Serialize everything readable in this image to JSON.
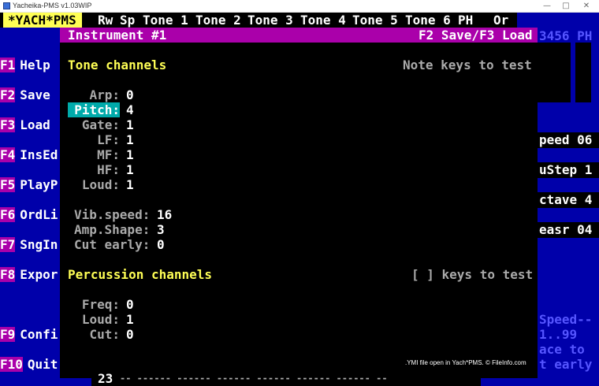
{
  "window": {
    "title": "Yacheika-PMS v1.03WIP"
  },
  "menu": {
    "logo": "*YACH*PMS",
    "columns": [
      "Rw",
      "Sp",
      "Tone 1",
      "Tone 2",
      "Tone 3",
      "Tone 4",
      "Tone 5",
      "Tone 6",
      "PH",
      "Or"
    ]
  },
  "header": {
    "title": "Instrument #1",
    "hint": "F2 Save/F3 Load",
    "right_text": "3456 PH"
  },
  "fkeys": [
    {
      "key": "F1",
      "label": "Help"
    },
    {
      "key": "F2",
      "label": "Save"
    },
    {
      "key": "F3",
      "label": "Load"
    },
    {
      "key": "F4",
      "label": "InsEd"
    },
    {
      "key": "F5",
      "label": "PlayP"
    },
    {
      "key": "F6",
      "label": "OrdLi"
    },
    {
      "key": "F7",
      "label": "SngIn"
    },
    {
      "key": "F8",
      "label": "Expor"
    },
    {
      "key": "F9",
      "label": "Confi"
    },
    {
      "key": "F10",
      "label": "Quit"
    }
  ],
  "tone": {
    "heading": "Tone channels",
    "hint": "Note keys to test",
    "fields": [
      {
        "label": "Arp:",
        "value": "0"
      },
      {
        "label": "Pitch:",
        "value": "4"
      },
      {
        "label": "Gate:",
        "value": "1"
      },
      {
        "label": "LF:",
        "value": "1"
      },
      {
        "label": "MF:",
        "value": "1"
      },
      {
        "label": "HF:",
        "value": "1"
      },
      {
        "label": "Loud:",
        "value": "1"
      }
    ],
    "extra": [
      {
        "label": "Vib.speed:",
        "value": "16"
      },
      {
        "label": "Amp.Shape:",
        "value": "3"
      },
      {
        "label": "Cut early:",
        "value": "0"
      }
    ]
  },
  "perc": {
    "heading": "Percussion channels",
    "hint": "[ ] keys to test",
    "fields": [
      {
        "label": "Freq:",
        "value": "0"
      },
      {
        "label": "Loud:",
        "value": "1"
      },
      {
        "label": "Cut:",
        "value": "0"
      }
    ]
  },
  "right_panel": {
    "speed": "peed 06",
    "ustep": "uStep 1",
    "octave": "ctave 4",
    "measr": "easr 04",
    "help1": "Speed--",
    "help2": "1..99",
    "help3": "ace to",
    "help4": "t early"
  },
  "bottom": {
    "row": "23",
    "dots": "-- ------ ------ ------ ------ ------ ------ --"
  },
  "watermark": ".YMI file open in Yach*PMS. © FileInfo.com",
  "colors": {
    "bg_blue": "#0000aa",
    "magenta": "#aa00aa",
    "yellow": "#ffff55",
    "cyan": "#00aaaa"
  }
}
